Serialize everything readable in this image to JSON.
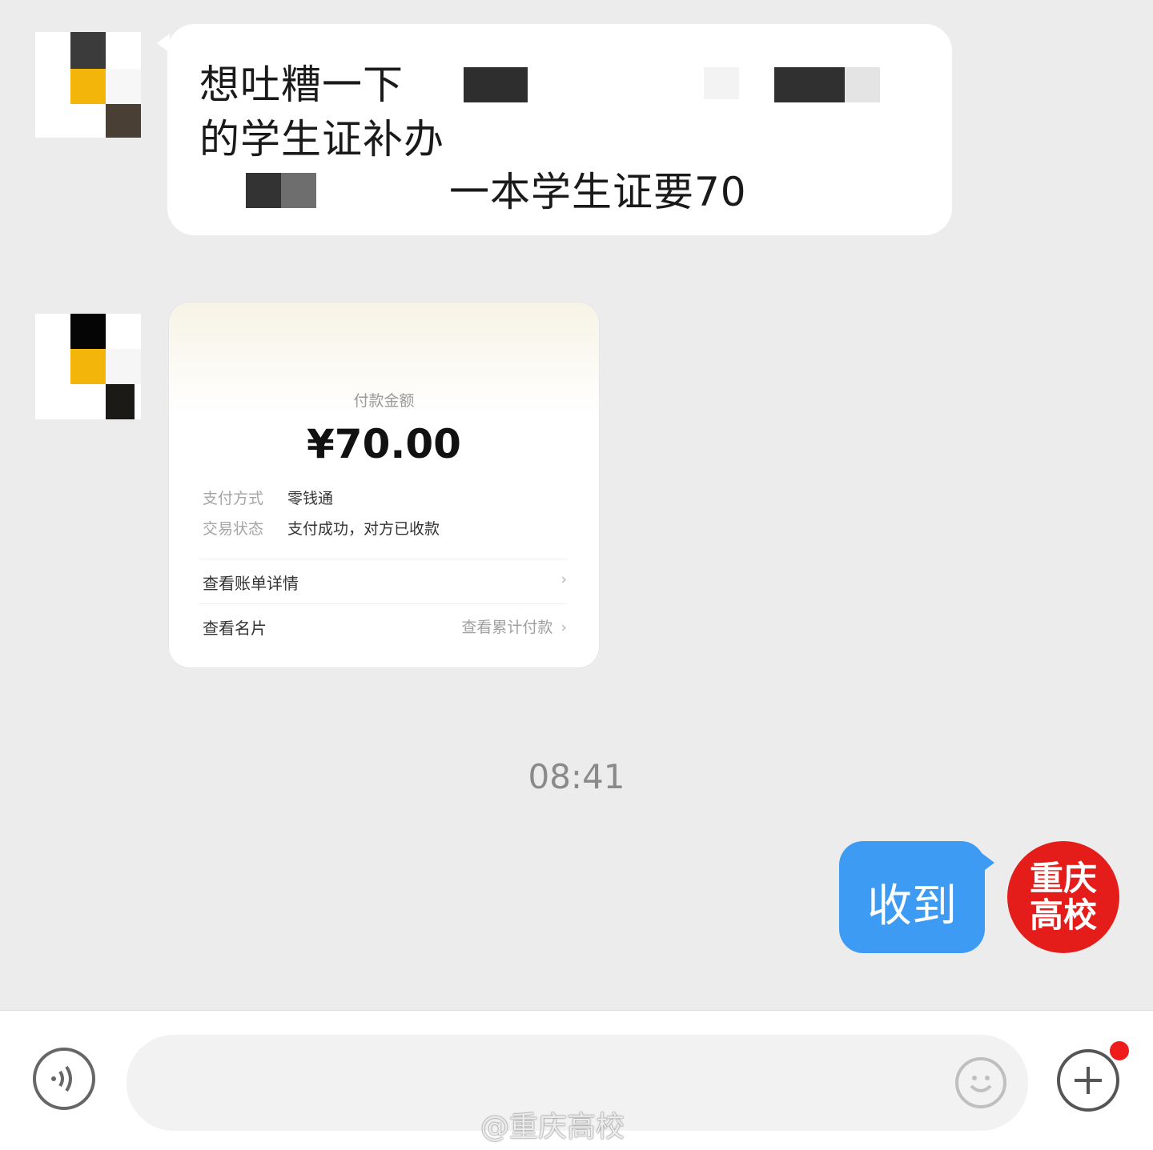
{
  "conversation": {
    "incoming_text": {
      "line1": "想吐糟一下",
      "line2": "的学生证补办",
      "line3": "一本学生证要70"
    },
    "payment_card": {
      "label": "付款金额",
      "amount": "¥70.00",
      "method_key": "支付方式",
      "method_value": "零钱通",
      "status_key": "交易状态",
      "status_value": "支付成功，对方已收款",
      "link_bill": "查看账单详情",
      "link_card": "查看名片",
      "link_card_right": "查看累计付款"
    },
    "timestamp": "08:41",
    "outgoing_text": "收到",
    "own_avatar_text": [
      "重庆",
      "高校"
    ]
  },
  "input_bar": {
    "placeholder": "",
    "icons": [
      "voice-icon",
      "emoji-icon",
      "plus-icon"
    ]
  },
  "watermark": "@重庆高校",
  "colors": {
    "background": "#ececec",
    "outgoing_bubble": "#3d9bf3",
    "avatar_red": "#e51d1a",
    "notification_dot": "#ef1c1c"
  }
}
